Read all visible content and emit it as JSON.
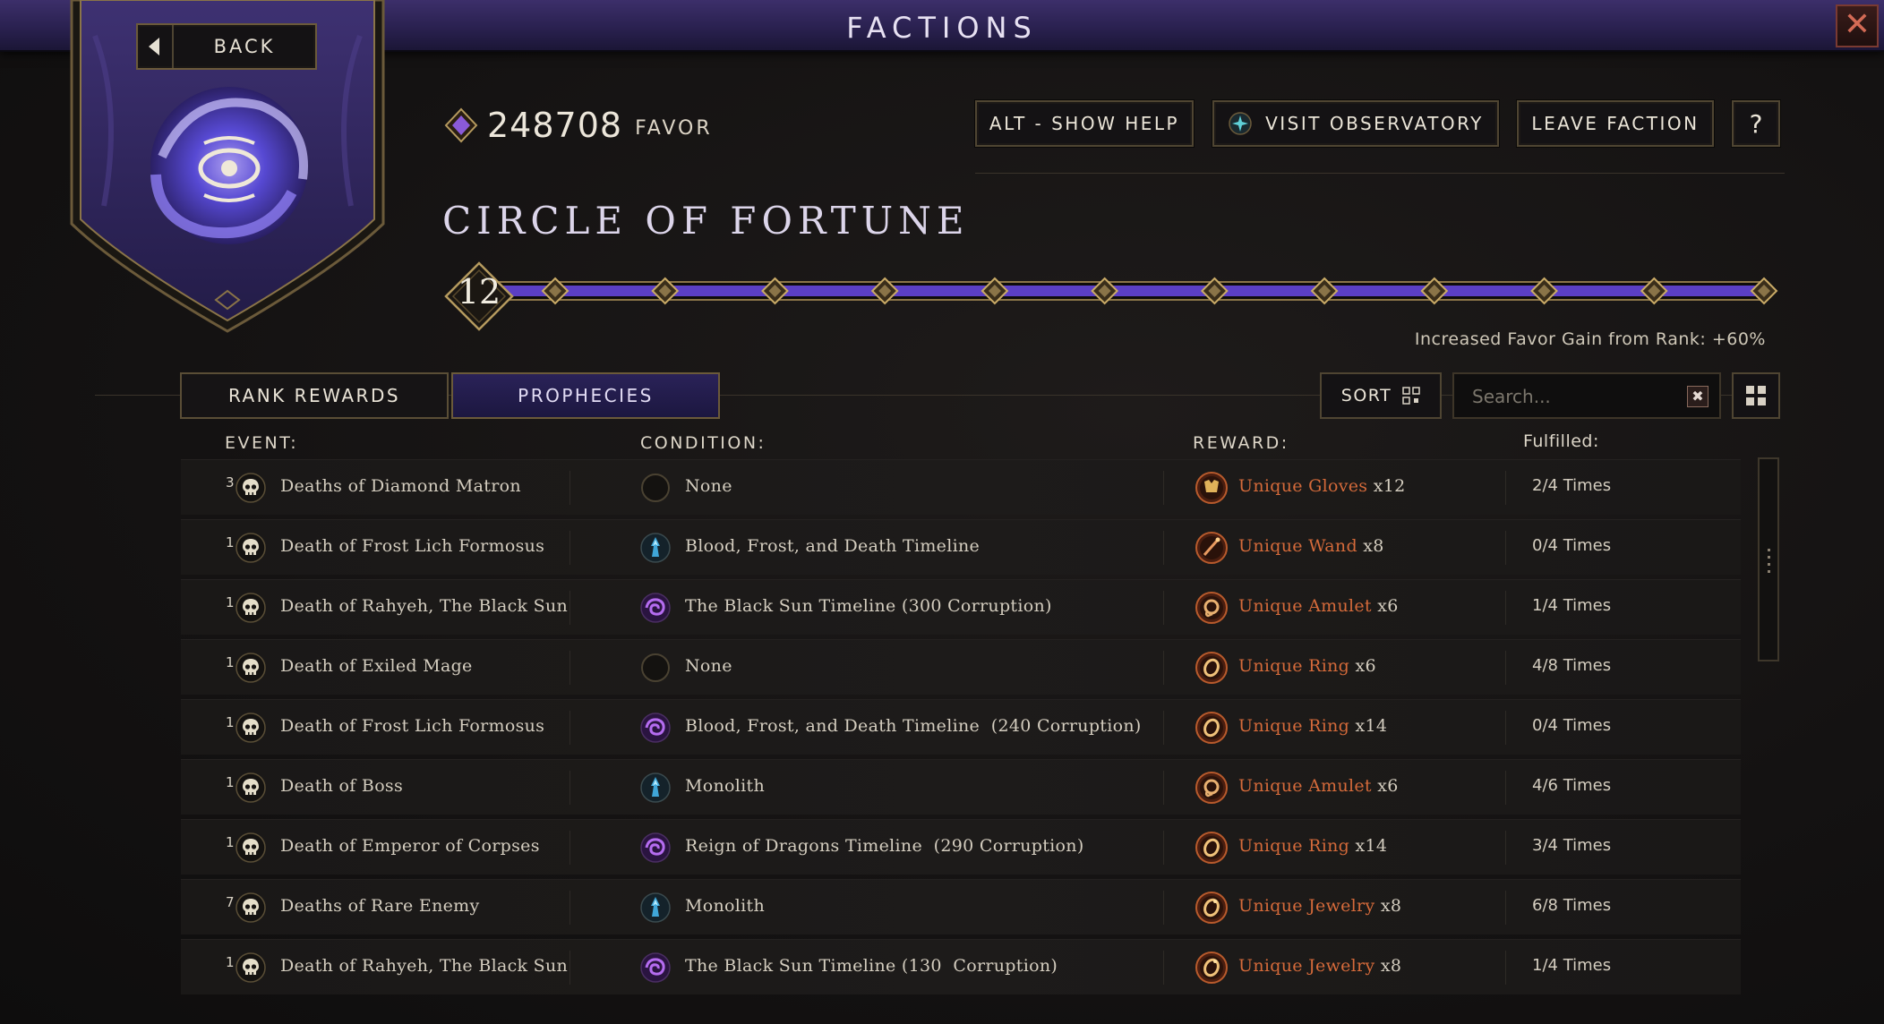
{
  "window": {
    "title": "FACTIONS",
    "close_symbol": "✕"
  },
  "back": {
    "label": "BACK"
  },
  "favor": {
    "value": "248708",
    "label": "FAVOR"
  },
  "header_buttons": {
    "help": "ALT - SHOW HELP",
    "observatory": "VISIT OBSERVATORY",
    "leave": "LEAVE FACTION",
    "question": "?"
  },
  "faction": {
    "name": "CIRCLE OF FORTUNE",
    "rank": "12",
    "rank_progress": 1.0,
    "rank_nodes": 12,
    "rank_note": "Increased Favor Gain from Rank: +60%"
  },
  "tabs": [
    {
      "label": "RANK REWARDS",
      "active": false
    },
    {
      "label": "PROPHECIES",
      "active": true
    }
  ],
  "toolbar": {
    "sort_label": "SORT",
    "search_placeholder": "Search...",
    "clear_symbol": "✖"
  },
  "columns": {
    "event": "EVENT:",
    "condition": "CONDITION:",
    "reward": "REWARD:",
    "fulfilled": "Fulfilled:"
  },
  "colors": {
    "accent_purple": "#5b3fc4",
    "reward_orange": "#d46a3a",
    "gold_trim": "#b59a5e",
    "monolith_blue": "#3fa6d8",
    "corruption_purple": "#8b3fd0"
  },
  "rows": [
    {
      "count": "3",
      "event": "Deaths of Diamond Matron",
      "condition_icon": "none-icon",
      "condition": "None",
      "reward_icon": "gloves-icon",
      "reward_item": "Unique Gloves",
      "reward_mult": "x12",
      "fulfilled": "2/4 Times"
    },
    {
      "count": "1",
      "event": "Death of Frost Lich Formosus",
      "condition_icon": "monolith-icon",
      "condition": "Blood, Frost, and Death Timeline",
      "reward_icon": "wand-icon",
      "reward_item": "Unique Wand",
      "reward_mult": "x8",
      "fulfilled": "0/4 Times"
    },
    {
      "count": "1",
      "event": "Death of Rahyeh, The Black Sun",
      "condition_icon": "corruption-icon",
      "condition": "The Black Sun Timeline (300 Corruption)",
      "reward_icon": "amulet-icon",
      "reward_item": "Unique Amulet",
      "reward_mult": "x6",
      "fulfilled": "1/4 Times"
    },
    {
      "count": "1",
      "event": "Death of Exiled Mage",
      "condition_icon": "none-icon",
      "condition": "None",
      "reward_icon": "ring-icon",
      "reward_item": "Unique Ring",
      "reward_mult": "x6",
      "fulfilled": "4/8 Times"
    },
    {
      "count": "1",
      "event": "Death of Frost Lich Formosus",
      "condition_icon": "corruption-icon",
      "condition": "Blood, Frost, and Death Timeline  (240 Corruption)",
      "reward_icon": "ring-icon",
      "reward_item": "Unique Ring",
      "reward_mult": "x14",
      "fulfilled": "0/4 Times"
    },
    {
      "count": "1",
      "event": "Death of Boss",
      "condition_icon": "monolith-icon",
      "condition": "Monolith",
      "reward_icon": "amulet-icon",
      "reward_item": "Unique Amulet",
      "reward_mult": "x6",
      "fulfilled": "4/6 Times"
    },
    {
      "count": "1",
      "event": "Death of Emperor of Corpses",
      "condition_icon": "corruption-icon",
      "condition": "Reign of Dragons Timeline  (290 Corruption)",
      "reward_icon": "ring-icon",
      "reward_item": "Unique Ring",
      "reward_mult": "x14",
      "fulfilled": "3/4 Times"
    },
    {
      "count": "7",
      "event": "Deaths of Rare Enemy",
      "condition_icon": "monolith-icon",
      "condition": "Monolith",
      "reward_icon": "jewelry-icon",
      "reward_item": "Unique Jewelry",
      "reward_mult": "x8",
      "fulfilled": "6/8 Times"
    },
    {
      "count": "1",
      "event": "Death of Rahyeh, The Black Sun",
      "condition_icon": "corruption-icon",
      "condition": "The Black Sun Timeline (130  Corruption)",
      "reward_icon": "jewelry-icon",
      "reward_item": "Unique Jewelry",
      "reward_mult": "x8",
      "fulfilled": "1/4 Times"
    }
  ]
}
